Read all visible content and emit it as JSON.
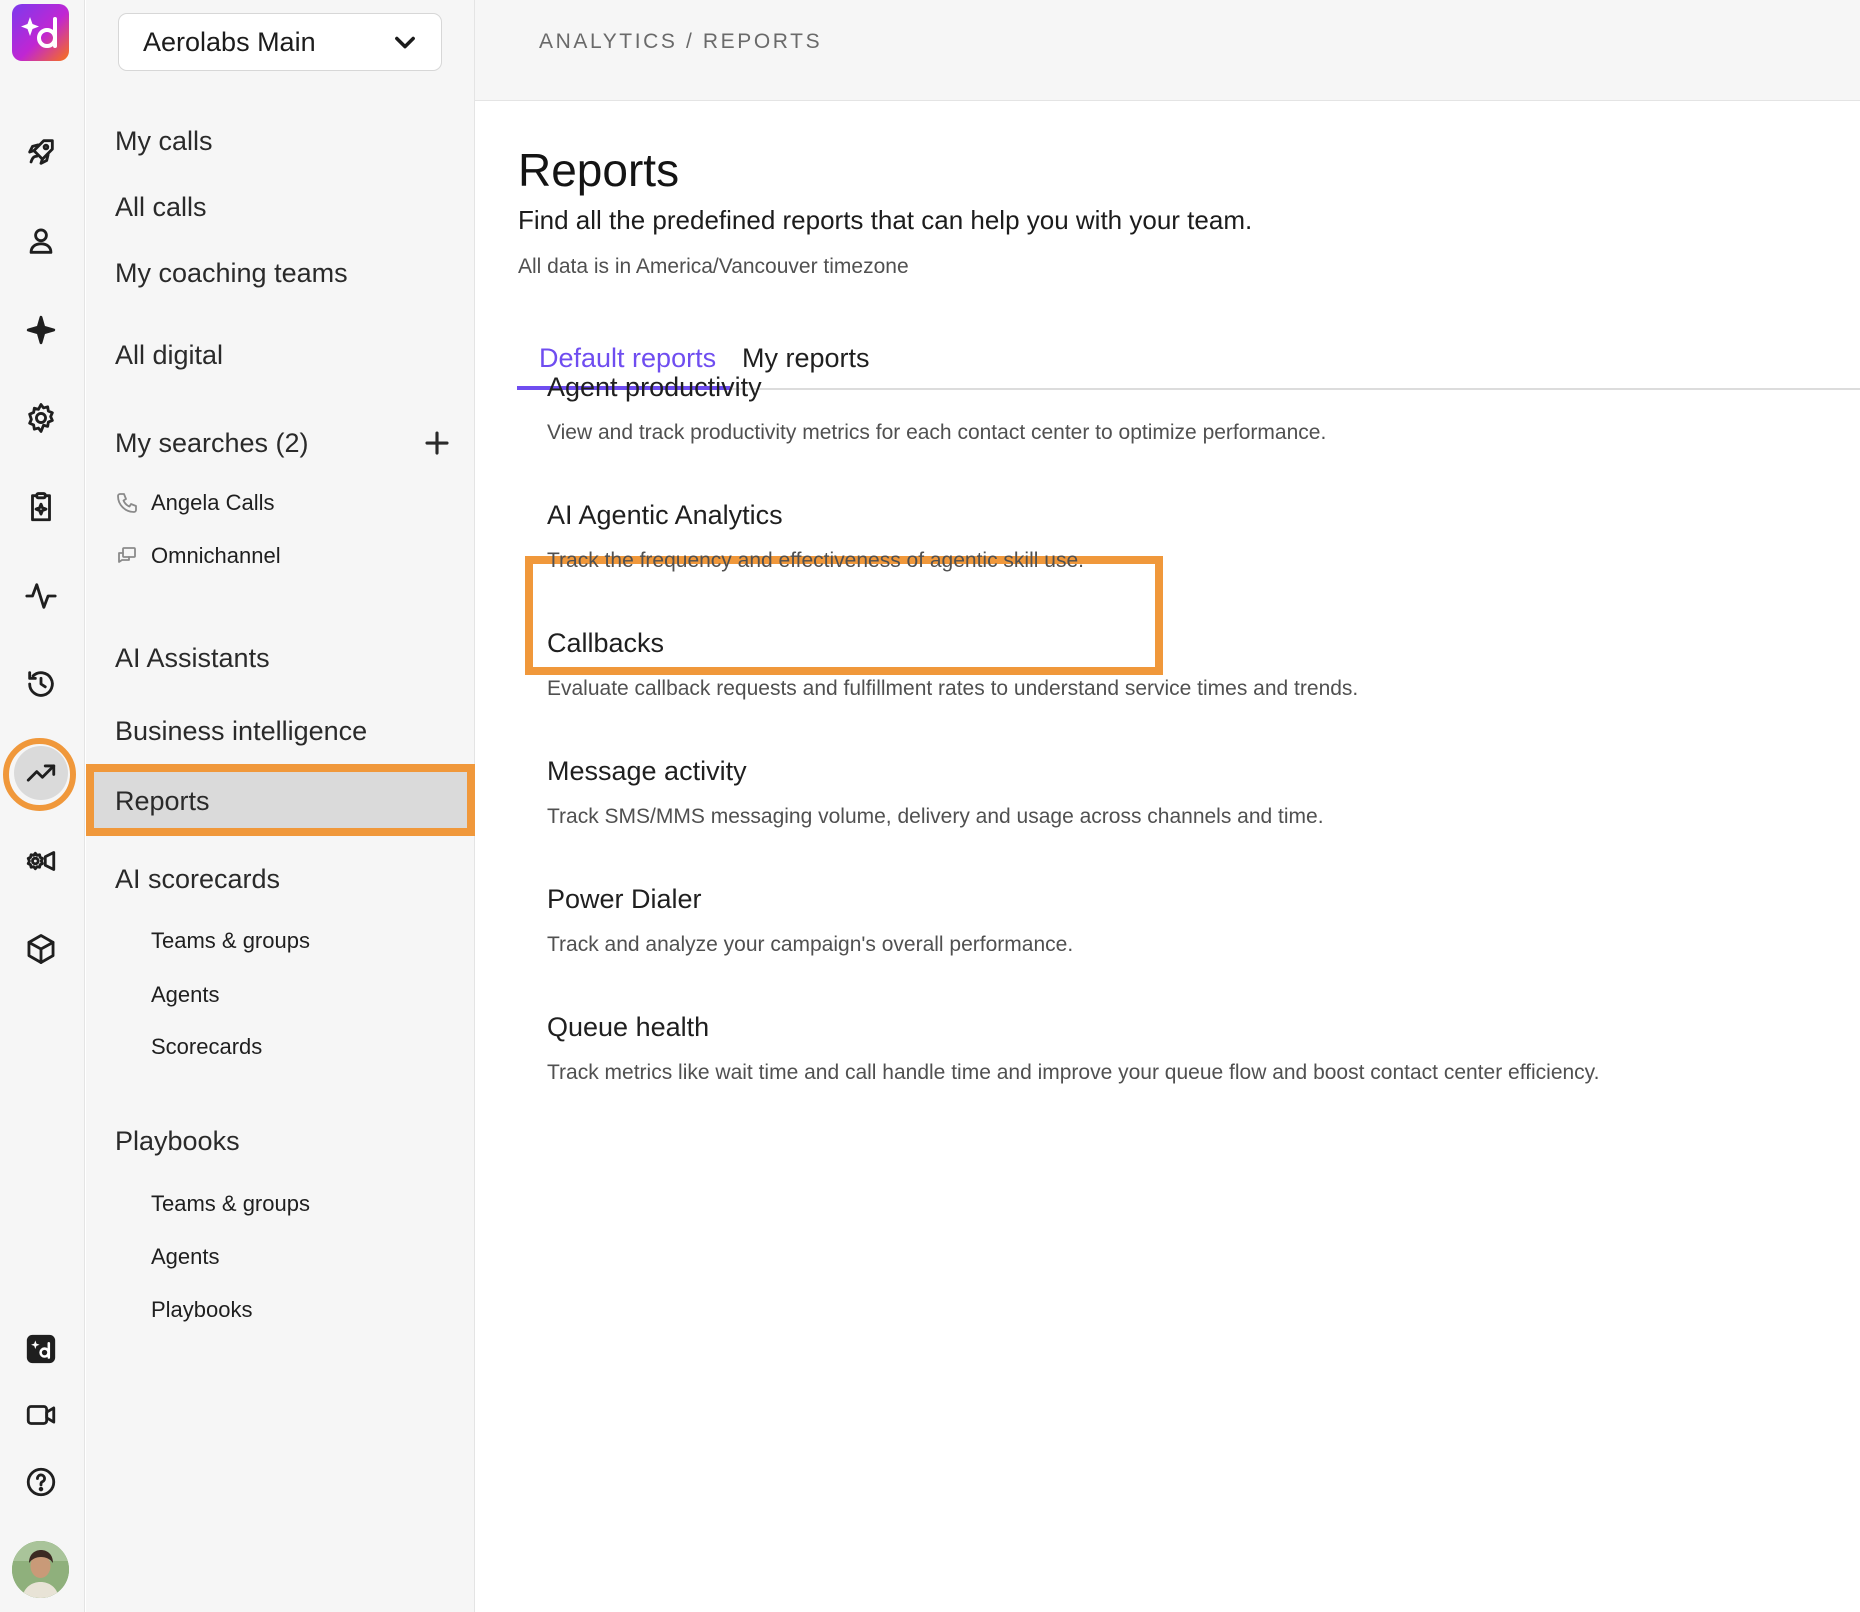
{
  "workspace": {
    "name": "Aerolabs Main"
  },
  "rail": {
    "icons": [
      "logo",
      "rocket-icon",
      "person-icon",
      "sparkle-icon",
      "gear-icon",
      "clipboard-sparkle-icon",
      "pulse-icon",
      "history-icon",
      "trending-up-icon",
      "camera-gear-icon",
      "cube-icon",
      "dialpad-logo-icon",
      "video-icon",
      "help-icon",
      "avatar"
    ],
    "active": "trending-up-icon"
  },
  "nav": {
    "my_calls": "My calls",
    "all_calls": "All calls",
    "my_coaching_teams": "My coaching teams",
    "all_digital": "All digital",
    "my_searches": "My searches (2)",
    "searches": [
      {
        "label": "Angela Calls",
        "icon": "phone-icon"
      },
      {
        "label": "Omnichannel",
        "icon": "chat-icon"
      }
    ],
    "ai_assistants": "AI Assistants",
    "business_intelligence": "Business intelligence",
    "reports": "Reports",
    "ai_scorecards": {
      "label": "AI scorecards",
      "items": [
        "Teams & groups",
        "Agents",
        "Scorecards"
      ]
    },
    "playbooks": {
      "label": "Playbooks",
      "items": [
        "Teams & groups",
        "Agents",
        "Playbooks"
      ]
    }
  },
  "header": {
    "breadcrumb": "ANALYTICS / REPORTS"
  },
  "main": {
    "title": "Reports",
    "subtitle": "Find all the predefined reports that can help you with your team.",
    "timezone_note": "All data is in America/Vancouver timezone",
    "tabs": [
      {
        "label": "Default reports",
        "active": true
      },
      {
        "label": "My reports",
        "active": false
      }
    ],
    "reports": [
      {
        "title": "Agent productivity",
        "description": "View and track productivity metrics for each contact center to optimize performance."
      },
      {
        "title": "AI Agentic Analytics",
        "description": "Track the frequency and effectiveness of agentic skill use.",
        "highlighted": true
      },
      {
        "title": "Callbacks",
        "description": "Evaluate callback requests and fulfillment rates to understand service times and trends."
      },
      {
        "title": "Message activity",
        "description": "Track SMS/MMS messaging volume, delivery and usage across channels and time."
      },
      {
        "title": "Power Dialer",
        "description": "Track and analyze your campaign's overall performance."
      },
      {
        "title": "Queue health",
        "description": "Track metrics like wait time and call handle time and improve your queue flow and boost contact center efficiency."
      }
    ]
  },
  "colors": {
    "accent": "#6f4df0",
    "highlight": "#f0983b",
    "sidebar_bg": "#f6f6f6"
  }
}
